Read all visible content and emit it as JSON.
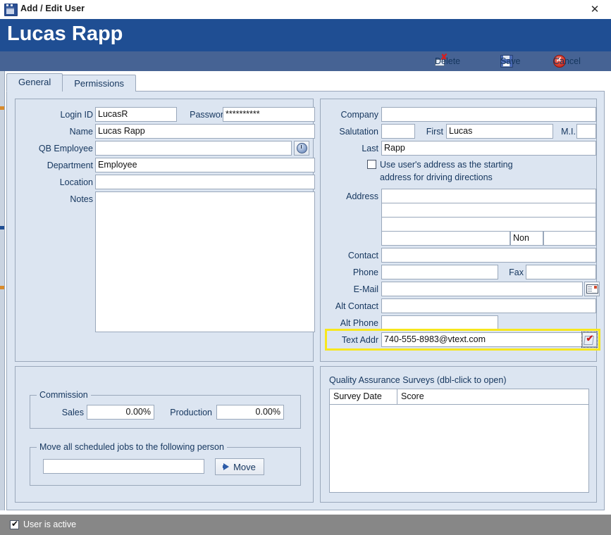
{
  "window": {
    "title": "Add / Edit User",
    "icon": "window-icon",
    "close_label": "✕"
  },
  "header": {
    "user_name": "Lucas Rapp"
  },
  "toolbar": {
    "delete_label": "Delete",
    "save_label": "Save",
    "cancel_label": "Cancel"
  },
  "tabs": [
    {
      "label": "General",
      "active": true
    },
    {
      "label": "Permissions",
      "active": false
    }
  ],
  "account": {
    "login_id_label": "Login ID",
    "login_id_value": "LucasR",
    "password_label": "Password",
    "password_value": "**********",
    "name_label": "Name",
    "name_value": "Lucas Rapp",
    "qb_employee_label": "QB Employee",
    "qb_employee_value": "",
    "department_label": "Department",
    "department_value": "Employee",
    "location_label": "Location",
    "location_value": "",
    "notes_label": "Notes",
    "notes_value": ""
  },
  "contact": {
    "company_label": "Company",
    "company_value": "",
    "salutation_label": "Salutation",
    "salutation_value": "",
    "first_label": "First",
    "first_value": "Lucas",
    "mi_label": "M.I.",
    "mi_value": "",
    "last_label": "Last",
    "last_value": "Rapp",
    "use_address_checkbox_line1": "Use user's address as the starting",
    "use_address_checkbox_line2": "address for driving directions",
    "use_address_checked": false,
    "address_label": "Address",
    "address_line1": "",
    "address_line2": "",
    "address_line3": "",
    "address_city": "",
    "address_region": "Non",
    "address_country": "",
    "contact_label": "Contact",
    "contact_value": "",
    "phone_label": "Phone",
    "phone_value": "",
    "fax_label": "Fax",
    "fax_value": "",
    "email_label": "E-Mail",
    "email_value": "",
    "alt_contact_label": "Alt Contact",
    "alt_contact_value": "",
    "alt_phone_label": "Alt Phone",
    "alt_phone_value": "",
    "text_addr_label": "Text Addr",
    "text_addr_value": "740-555-8983@vtext.com"
  },
  "commission": {
    "caption": "Commission",
    "sales_label": "Sales",
    "sales_value": "0.00%",
    "production_label": "Production",
    "production_value": "0.00%"
  },
  "move_jobs": {
    "caption": "Move all scheduled jobs to the following person",
    "person_value": "",
    "move_button_label": "Move"
  },
  "surveys": {
    "title": "Quality Assurance Surveys (dbl-click to open)",
    "columns": [
      "Survey Date",
      "Score"
    ],
    "rows": []
  },
  "statusbar": {
    "user_is_active_label": "User is active",
    "user_is_active_checked": true
  },
  "colors": {
    "header_blue": "#1f4e93",
    "command_bar_blue": "#466394",
    "panel_blue": "#dce5f1",
    "highlight_yellow": "#f7e71d",
    "status_gray": "#878787"
  }
}
